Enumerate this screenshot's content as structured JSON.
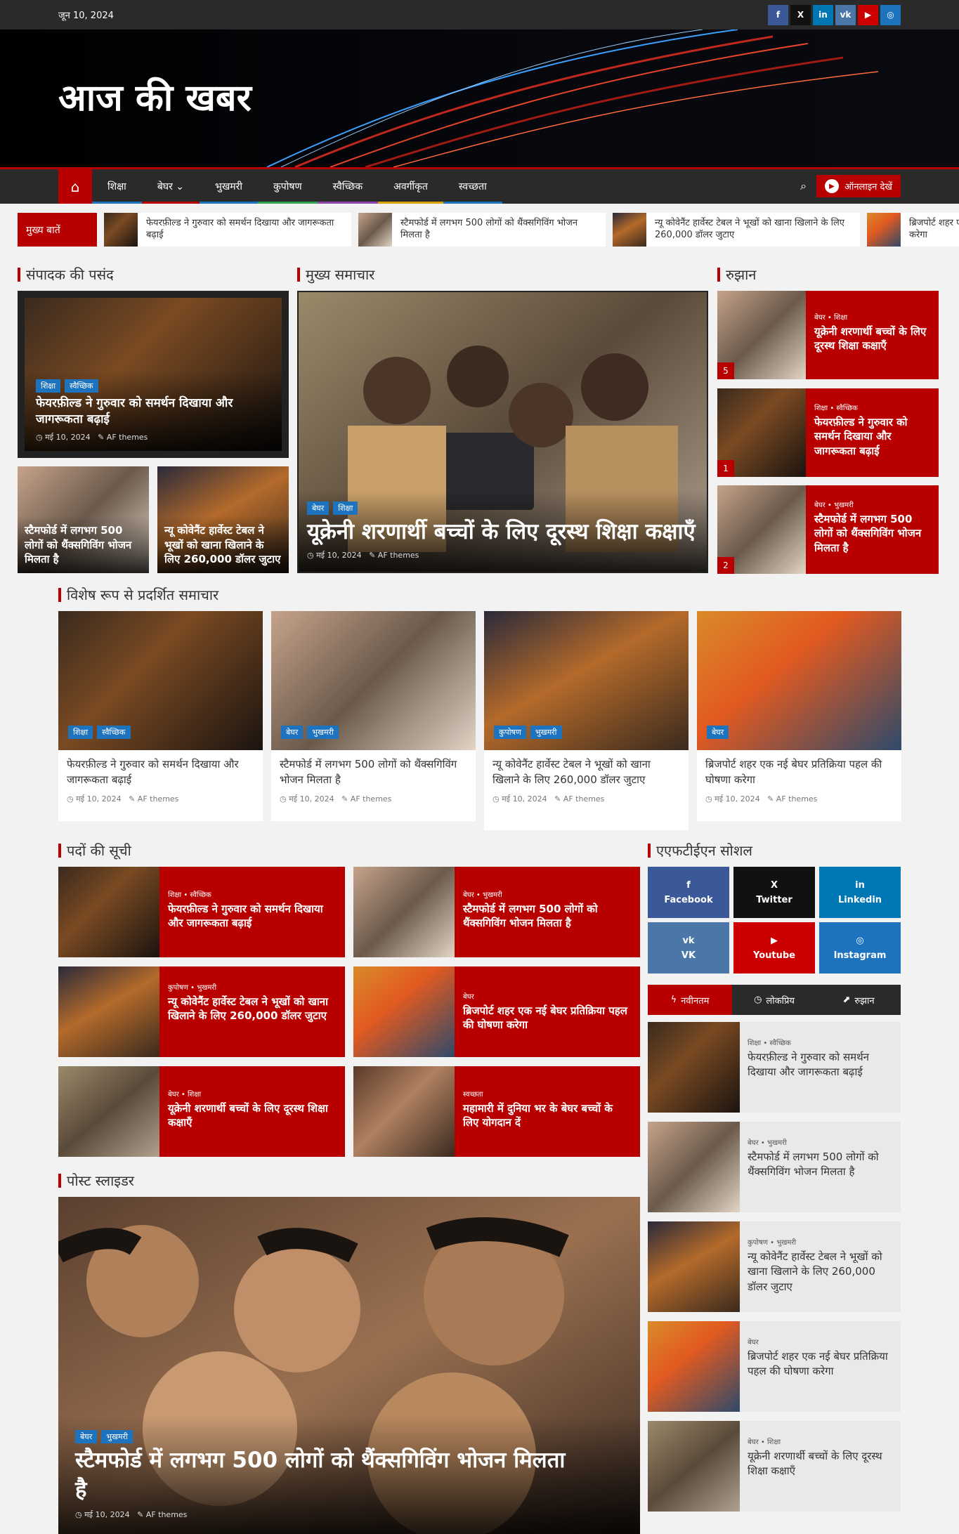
{
  "topbar": {
    "date": "जून 10, 2024"
  },
  "socials_top": [
    {
      "icon": "facebook-icon",
      "glyph": "f",
      "color": "#3b5998"
    },
    {
      "icon": "x-twitter-icon",
      "glyph": "X",
      "color": "#111111"
    },
    {
      "icon": "linkedin-icon",
      "glyph": "in",
      "color": "#0077b5"
    },
    {
      "icon": "vk-icon",
      "glyph": "vk",
      "color": "#4a76a8"
    },
    {
      "icon": "youtube-icon",
      "glyph": "▶",
      "color": "#cc0000"
    },
    {
      "icon": "instagram-icon",
      "glyph": "◎",
      "color": "#1e73be"
    }
  ],
  "site": {
    "title": "आज की खबर"
  },
  "nav": {
    "items": [
      {
        "label": "शिक्षा",
        "color": "#1e73be"
      },
      {
        "label": "बेघर ⌄",
        "color": "#b80000"
      },
      {
        "label": "भुखमरी",
        "color": "#1e73be"
      },
      {
        "label": "कुपोषण",
        "color": "#2ea44f"
      },
      {
        "label": "स्वैच्छिक",
        "color": "#8e44ad"
      },
      {
        "label": "अवर्गीकृत",
        "color": "#d6a200"
      },
      {
        "label": "स्वच्छता",
        "color": "#1e73be"
      }
    ],
    "watch_label": "ऑनलाइन देखें"
  },
  "ticker": {
    "label": "मुख्य बातें",
    "items": [
      {
        "text": "फेयरफ़ील्ड ने गुरुवार को समर्थन दिखाया और जागरूकता बढ़ाई"
      },
      {
        "text": "स्टैमफोर्ड में लगभग 500 लोगों को थैंक्सगिविंग भोजन मिलता है"
      },
      {
        "text": "न्यू कोवेनैंट हार्वेस्ट टेबल ने भूखों को खाना खिलाने के लिए 260,000 डॉलर जुटाए"
      },
      {
        "text": "ब्रिजपोर्ट शहर एक नई बेघर प्रतिक्रिया पहल की घोषणा करेगा"
      }
    ]
  },
  "editors_pick": {
    "title": "संपादक की पसंद",
    "main": {
      "cats": [
        "शिक्षा",
        "स्वैच्छिक"
      ],
      "title": "फेयरफ़ील्ड ने गुरुवार को समर्थन दिखाया और जागरूकता बढ़ाई",
      "date": "मई 10, 2024",
      "author": "AF themes"
    },
    "small": [
      {
        "title": "स्टैमफोर्ड में लगभग 500 लोगों को थैंक्सगिविंग भोजन मिलता है"
      },
      {
        "title": "न्यू कोवेनैंट हार्वेस्ट टेबल ने भूखों को खाना खिलाने के लिए 260,000 डॉलर जुटाए"
      }
    ]
  },
  "main_news": {
    "title": "मुख्य समाचार",
    "cats": [
      "बेघर",
      "शिक्षा"
    ],
    "headline": "यूक्रेनी शरणार्थी बच्चों के लिए दूरस्थ शिक्षा कक्षाएँ",
    "date": "मई 10, 2024",
    "author": "AF themes"
  },
  "trending": {
    "title": "रुझान",
    "items": [
      {
        "cats": "बेघर  •  शिक्षा",
        "title": "यूक्रेनी शरणार्थी बच्चों के लिए दूरस्थ शिक्षा कक्षाएँ",
        "rank": "5"
      },
      {
        "cats": "शिक्षा  •  स्वैच्छिक",
        "title": "फेयरफ़ील्ड ने गुरुवार को समर्थन दिखाया और जागरूकता बढ़ाई",
        "rank": "1"
      },
      {
        "cats": "बेघर  •  भुखमरी",
        "title": "स्टैमफोर्ड में लगभग 500 लोगों को थैंक्सगिविंग भोजन मिलता है",
        "rank": "2"
      }
    ]
  },
  "featured": {
    "title": "विशेष रूप से प्रदर्शित समाचार",
    "items": [
      {
        "cats": [
          "शिक्षा",
          "स्वैच्छिक"
        ],
        "title": "फेयरफ़ील्ड ने गुरुवार को समर्थन दिखाया और जागरूकता बढ़ाई",
        "date": "मई 10, 2024",
        "author": "AF themes"
      },
      {
        "cats": [
          "बेघर",
          "भुखमरी"
        ],
        "title": "स्टैमफोर्ड में लगभग 500 लोगों को थैंक्सगिविंग भोजन मिलता है",
        "date": "मई 10, 2024",
        "author": "AF themes"
      },
      {
        "cats": [
          "कुपोषण",
          "भुखमरी"
        ],
        "title": "न्यू कोवेनैंट हार्वेस्ट टेबल ने भूखों को खाना खिलाने के लिए 260,000 डॉलर जुटाए",
        "date": "मई 10, 2024",
        "author": "AF themes"
      },
      {
        "cats": [
          "बेघर"
        ],
        "title": "ब्रिजपोर्ट शहर एक नई बेघर प्रतिक्रिया पहल की घोषणा करेगा",
        "date": "मई 10, 2024",
        "author": "AF themes"
      }
    ]
  },
  "post_list": {
    "title": "पदों की सूची",
    "items": [
      {
        "cats": "शिक्षा  •  स्वैच्छिक",
        "title": "फेयरफ़ील्ड ने गुरुवार को समर्थन दिखाया और जागरूकता बढ़ाई"
      },
      {
        "cats": "बेघर  •  भुखमरी",
        "title": "स्टैमफोर्ड में लगभग 500 लोगों को थैंक्सगिविंग भोजन मिलता है"
      },
      {
        "cats": "कुपोषण  •  भुखमरी",
        "title": "न्यू कोवेनैंट हार्वेस्ट टेबल ने भूखों को खाना खिलाने के लिए 260,000 डॉलर जुटाए"
      },
      {
        "cats": "बेघर",
        "title": "ब्रिजपोर्ट शहर एक नई बेघर प्रतिक्रिया पहल की घोषणा करेगा"
      },
      {
        "cats": "बेघर  •  शिक्षा",
        "title": "यूक्रेनी शरणार्थी बच्चों के लिए दूरस्थ शिक्षा कक्षाएँ"
      },
      {
        "cats": "स्वच्छता",
        "title": "महामारी में दुनिया भर के बेघर बच्चों के लिए योगदान दें"
      }
    ]
  },
  "social": {
    "title": "एएफटीईएन सोशल",
    "items": [
      {
        "name": "Facebook",
        "icon": "facebook-icon",
        "glyph": "f",
        "color": "#3b5998"
      },
      {
        "name": "Twitter",
        "icon": "x-twitter-icon",
        "glyph": "X",
        "color": "#111111"
      },
      {
        "name": "Linkedin",
        "icon": "linkedin-icon",
        "glyph": "in",
        "color": "#0077b5"
      },
      {
        "name": "VK",
        "icon": "vk-icon",
        "glyph": "vk",
        "color": "#4a76a8"
      },
      {
        "name": "Youtube",
        "icon": "youtube-icon",
        "glyph": "▶",
        "color": "#cc0000"
      },
      {
        "name": "Instagram",
        "icon": "instagram-icon",
        "glyph": "◎",
        "color": "#1e73be"
      }
    ]
  },
  "tabs": {
    "items": [
      {
        "label": "नवीनतम",
        "glyph": "ϟ"
      },
      {
        "label": "लोकप्रिय",
        "glyph": "◷"
      },
      {
        "label": "रुझान",
        "glyph": "⬈"
      }
    ]
  },
  "sidebar_list": [
    {
      "cats": "शिक्षा  •  स्वैच्छिक",
      "title": "फेयरफ़ील्ड ने गुरुवार को समर्थन दिखाया और जागरूकता बढ़ाई"
    },
    {
      "cats": "बेघर  •  भुखमरी",
      "title": "स्टैमफोर्ड में लगभग 500 लोगों को थैंक्सगिविंग भोजन मिलता है"
    },
    {
      "cats": "कुपोषण  •  भुखमरी",
      "title": "न्यू कोवेनैंट हार्वेस्ट टेबल ने भूखों को खाना खिलाने के लिए 260,000 डॉलर जुटाए"
    },
    {
      "cats": "बेघर",
      "title": "ब्रिजपोर्ट शहर एक नई बेघर प्रतिक्रिया पहल की घोषणा करेगा"
    },
    {
      "cats": "बेघर  •  शिक्षा",
      "title": "यूक्रेनी शरणार्थी बच्चों के लिए दूरस्थ शिक्षा कक्षाएँ"
    }
  ],
  "slider": {
    "title": "पोस्ट स्लाइडर",
    "cats": [
      "बेघर",
      "भुखमरी"
    ],
    "headline": "स्टैमफोर्ड में लगभग 500 लोगों को थैंक्सगिविंग भोजन मिलता है",
    "date": "मई 10, 2024",
    "author": "AF themes"
  }
}
